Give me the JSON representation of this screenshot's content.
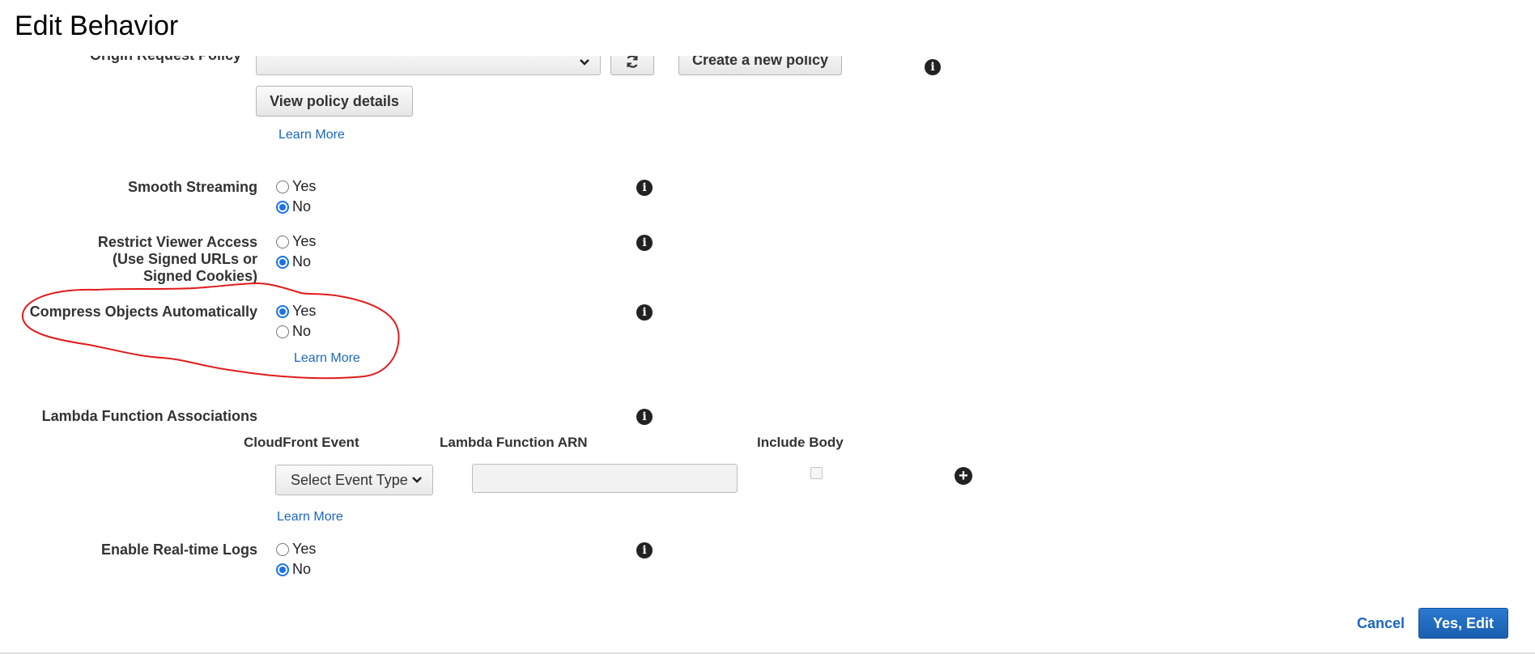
{
  "dialog": {
    "title": "Edit Behavior"
  },
  "origin_request_policy": {
    "label": "Origin Request Policy",
    "selected_value": "",
    "create_button": "Create a new policy",
    "view_button": "View policy details",
    "learn_more": "Learn More"
  },
  "smooth_streaming": {
    "label": "Smooth Streaming",
    "options": [
      "Yes",
      "No"
    ],
    "selected": "No"
  },
  "restrict_viewer_access": {
    "label_lines": [
      "Restrict Viewer Access",
      "(Use Signed URLs or",
      "Signed Cookies)"
    ],
    "options": [
      "Yes",
      "No"
    ],
    "selected": "No"
  },
  "compress_objects": {
    "label": "Compress Objects Automatically",
    "options": [
      "Yes",
      "No"
    ],
    "selected": "Yes",
    "learn_more": "Learn More",
    "annotation_color": "#e11b1b"
  },
  "lambda_associations": {
    "label": "Lambda Function Associations",
    "columns": [
      "CloudFront Event",
      "Lambda Function ARN",
      "Include Body"
    ],
    "event_select": "Select Event Type",
    "arn_value": "",
    "include_body": false,
    "learn_more": "Learn More"
  },
  "realtime_logs": {
    "label": "Enable Real-time Logs",
    "options": [
      "Yes",
      "No"
    ],
    "selected": "No"
  },
  "footer": {
    "cancel": "Cancel",
    "submit": "Yes, Edit"
  },
  "icons": {
    "info": "info-icon",
    "refresh": "refresh-icon",
    "chevron": "chevron-down-icon",
    "add": "plus-circle-icon"
  },
  "colors": {
    "link": "#1a66c1",
    "primary": "#1f6bc3",
    "radio_checked": "#1a73e8"
  }
}
